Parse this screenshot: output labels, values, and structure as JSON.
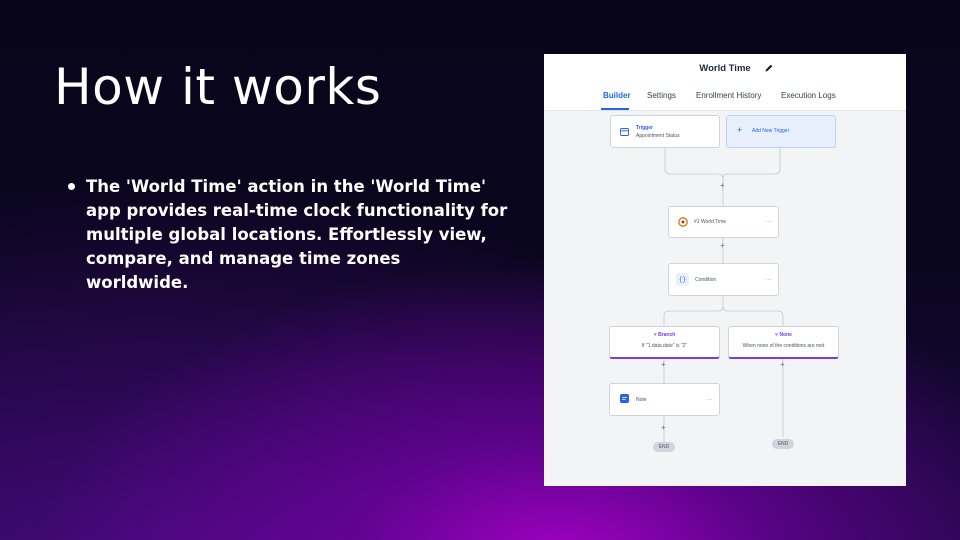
{
  "slide": {
    "title": "How it works",
    "bullets": [
      "The 'World Time' action in the 'World Time' app provides real-time clock functionality for multiple global locations. Effortlessly view, compare, and manage time zones worldwide."
    ]
  },
  "screenshot": {
    "title": "World Time",
    "tabs": [
      {
        "label": "Builder",
        "active": true
      },
      {
        "label": "Settings",
        "active": false
      },
      {
        "label": "Enrollment History",
        "active": false
      },
      {
        "label": "Execution Logs",
        "active": false
      }
    ],
    "trigger": {
      "label": "Trigger",
      "sub": "Appointment Status"
    },
    "add_trigger": {
      "label": "Add New Trigger"
    },
    "action": {
      "label": "#1 World Time"
    },
    "condition": {
      "label": "Condition"
    },
    "branch": {
      "label": "Branch",
      "sub": "If \"1.data.date\" is \"2\""
    },
    "none": {
      "label": "None",
      "sub": "When none of the conditions are met"
    },
    "note": {
      "label": "Note"
    },
    "end_label": "END",
    "colors": {
      "accent": "#2563eb",
      "branch": "#7c3aed"
    }
  }
}
